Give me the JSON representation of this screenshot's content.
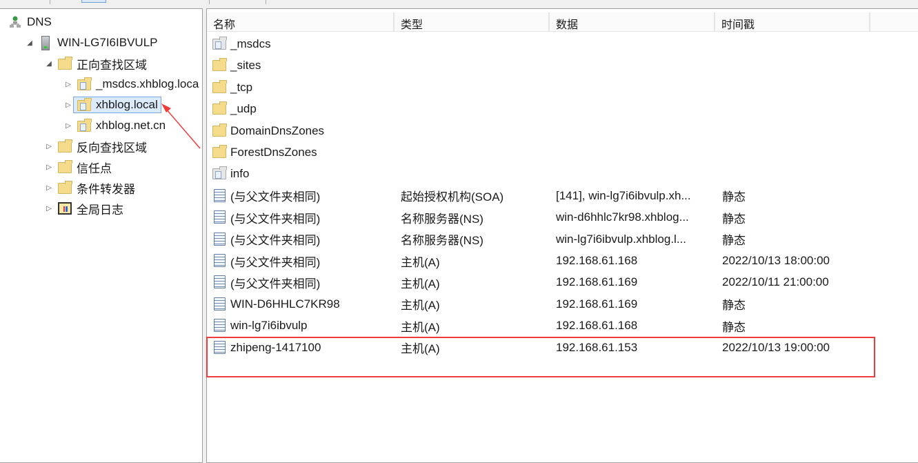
{
  "tree": [
    {
      "label": "DNS",
      "icon": "dns-icon",
      "toggle": "",
      "level": 0
    },
    {
      "label": "WIN-LG7I6IBVULP",
      "icon": "server-icon",
      "toggle": "expanded",
      "level": 1
    },
    {
      "label": "正向查找区域",
      "icon": "folder-icon",
      "toggle": "expanded",
      "level": 2
    },
    {
      "label": "_msdcs.xhblog.loca",
      "icon": "zone-icon",
      "toggle": "collapsed",
      "level": 3
    },
    {
      "label": "xhblog.local",
      "icon": "zone-icon",
      "toggle": "collapsed",
      "level": 3,
      "selected": true
    },
    {
      "label": "xhblog.net.cn",
      "icon": "zone-icon",
      "toggle": "collapsed",
      "level": 3
    },
    {
      "label": "反向查找区域",
      "icon": "folder-icon",
      "toggle": "collapsed",
      "level": 2
    },
    {
      "label": "信任点",
      "icon": "folder-icon",
      "toggle": "collapsed",
      "level": 2
    },
    {
      "label": "条件转发器",
      "icon": "folder-icon",
      "toggle": "collapsed",
      "level": 2
    },
    {
      "label": "全局日志",
      "icon": "log-icon",
      "toggle": "collapsed",
      "level": 2
    }
  ],
  "columns": [
    "名称",
    "类型",
    "数据",
    "时间戳"
  ],
  "rows": [
    {
      "name": "_msdcs",
      "type": "",
      "data": "",
      "ts": "",
      "icon": "delegated-zone-icon"
    },
    {
      "name": "_sites",
      "type": "",
      "data": "",
      "ts": "",
      "icon": "folder-icon"
    },
    {
      "name": "_tcp",
      "type": "",
      "data": "",
      "ts": "",
      "icon": "folder-icon"
    },
    {
      "name": "_udp",
      "type": "",
      "data": "",
      "ts": "",
      "icon": "folder-icon"
    },
    {
      "name": "DomainDnsZones",
      "type": "",
      "data": "",
      "ts": "",
      "icon": "folder-icon"
    },
    {
      "name": "ForestDnsZones",
      "type": "",
      "data": "",
      "ts": "",
      "icon": "folder-icon"
    },
    {
      "name": "info",
      "type": "",
      "data": "",
      "ts": "",
      "icon": "delegated-zone-icon"
    },
    {
      "name": "(与父文件夹相同)",
      "type": "起始授权机构(SOA)",
      "data": "[141], win-lg7i6ibvulp.xh...",
      "ts": "静态",
      "icon": "record-icon"
    },
    {
      "name": "(与父文件夹相同)",
      "type": "名称服务器(NS)",
      "data": "win-d6hhlc7kr98.xhblog...",
      "ts": "静态",
      "icon": "record-icon"
    },
    {
      "name": "(与父文件夹相同)",
      "type": "名称服务器(NS)",
      "data": "win-lg7i6ibvulp.xhblog.l...",
      "ts": "静态",
      "icon": "record-icon"
    },
    {
      "name": "(与父文件夹相同)",
      "type": "主机(A)",
      "data": "192.168.61.168",
      "ts": "2022/10/13 18:00:00",
      "icon": "record-icon"
    },
    {
      "name": "(与父文件夹相同)",
      "type": "主机(A)",
      "data": "192.168.61.169",
      "ts": "2022/10/11 21:00:00",
      "icon": "record-icon"
    },
    {
      "name": "WIN-D6HHLC7KR98",
      "type": "主机(A)",
      "data": "192.168.61.169",
      "ts": "静态",
      "icon": "record-icon"
    },
    {
      "name": "win-lg7i6ibvulp",
      "type": "主机(A)",
      "data": "192.168.61.168",
      "ts": "静态",
      "icon": "record-icon"
    },
    {
      "name": "zhipeng-1417100",
      "type": "主机(A)",
      "data": "192.168.61.153",
      "ts": "2022/10/13 19:00:00",
      "icon": "record-icon"
    }
  ],
  "colors": {
    "annotation": "#f03b3b",
    "selection": "#dcebfc"
  }
}
